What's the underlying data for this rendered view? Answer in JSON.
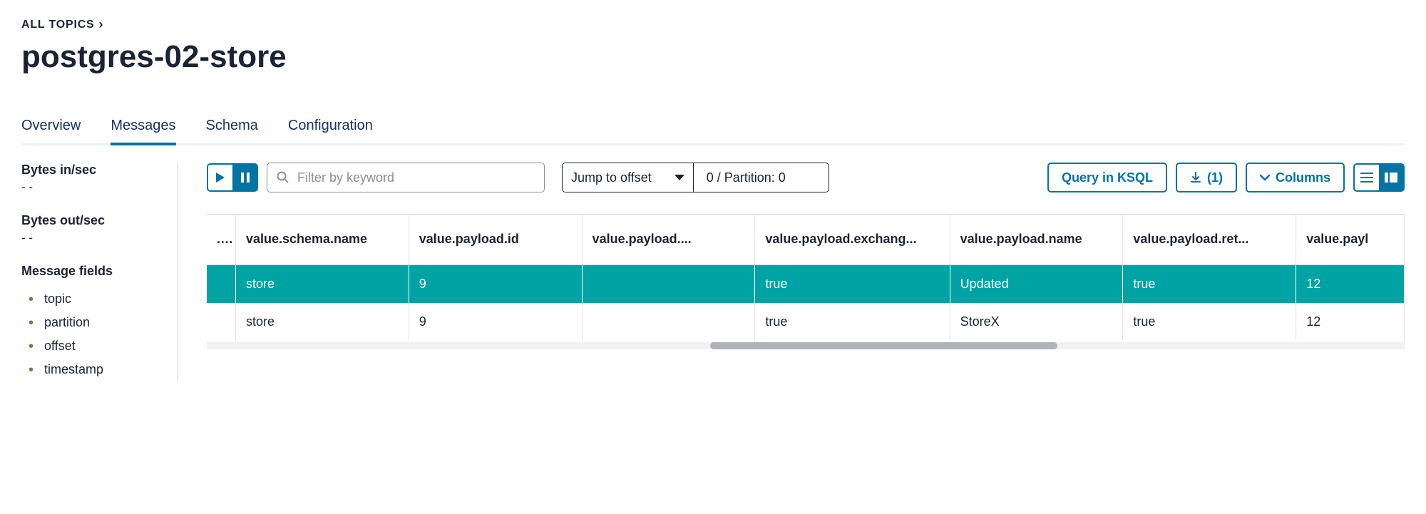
{
  "breadcrumb": {
    "label": "ALL TOPICS"
  },
  "page": {
    "title": "postgres-02-store"
  },
  "tabs": [
    {
      "label": "Overview",
      "active": false
    },
    {
      "label": "Messages",
      "active": true
    },
    {
      "label": "Schema",
      "active": false
    },
    {
      "label": "Configuration",
      "active": false
    }
  ],
  "sidebar": {
    "stats": [
      {
        "label": "Bytes in/sec",
        "value": "- -"
      },
      {
        "label": "Bytes out/sec",
        "value": "- -"
      }
    ],
    "fields_title": "Message fields",
    "fields": [
      "topic",
      "partition",
      "offset",
      "timestamp"
    ]
  },
  "toolbar": {
    "filter_placeholder": "Filter by keyword",
    "jump_label": "Jump to offset",
    "offset_display": "0 / Partition: 0",
    "query_label": "Query in KSQL",
    "download_count": "(1)",
    "columns_label": "Columns"
  },
  "table": {
    "columns": [
      "...",
      "value.schema.name",
      "value.payload.id",
      "value.payload....",
      "value.payload.exchang...",
      "value.payload.name",
      "value.payload.ret...",
      "value.payl"
    ],
    "rows": [
      {
        "highlight": true,
        "cells": [
          "",
          "store",
          "9",
          "",
          "true",
          "Updated",
          "true",
          "12"
        ]
      },
      {
        "highlight": false,
        "cells": [
          "",
          "store",
          "9",
          "",
          "true",
          "StoreX",
          "true",
          "12"
        ]
      }
    ]
  }
}
